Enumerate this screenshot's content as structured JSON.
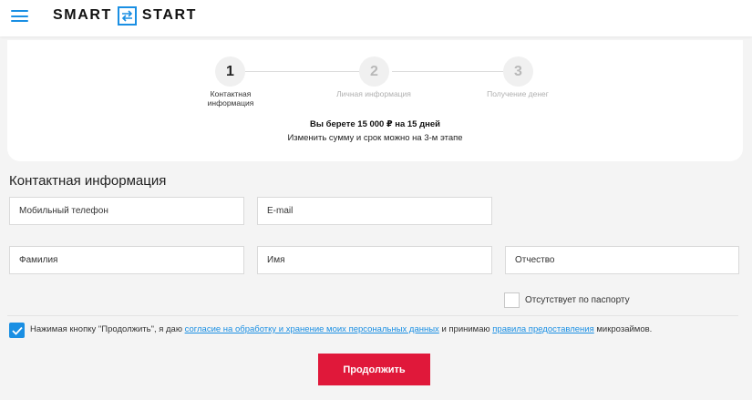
{
  "header": {
    "logo_left": "SMART",
    "logo_right": "START",
    "menu_icon": "hamburger-menu-icon",
    "logo_icon": "exchange-arrows-icon",
    "accent_color": "#1a8fe3"
  },
  "steps": [
    {
      "number": "1",
      "label": "Контактная информация",
      "state": "active"
    },
    {
      "number": "2",
      "label": "Личная информация",
      "state": "inactive"
    },
    {
      "number": "3",
      "label": "Получение денег",
      "state": "inactive"
    }
  ],
  "summary": {
    "line1": "Вы берете 15 000 ₽ на 15 дней",
    "line2": "Изменить сумму и срок можно на 3-м этапе"
  },
  "form": {
    "title": "Контактная информация",
    "phone_placeholder": "Мобильный телефон",
    "email_placeholder": "E-mail",
    "lastname_placeholder": "Фамилия",
    "firstname_placeholder": "Имя",
    "patronymic_placeholder": "Отчество",
    "no_patronymic_label": "Отсутствует по паспорту",
    "no_patronymic_checked": false
  },
  "consent": {
    "checked": true,
    "text_before": "Нажимая кнопку \"Продолжить\", я даю ",
    "link1": "согласие на обработку и хранение моих персональных данных",
    "text_middle": " и принимаю ",
    "link2": "правила предоставления",
    "text_after": " микрозаймов."
  },
  "button": {
    "continue_label": "Продолжить",
    "color": "#e0183a"
  }
}
